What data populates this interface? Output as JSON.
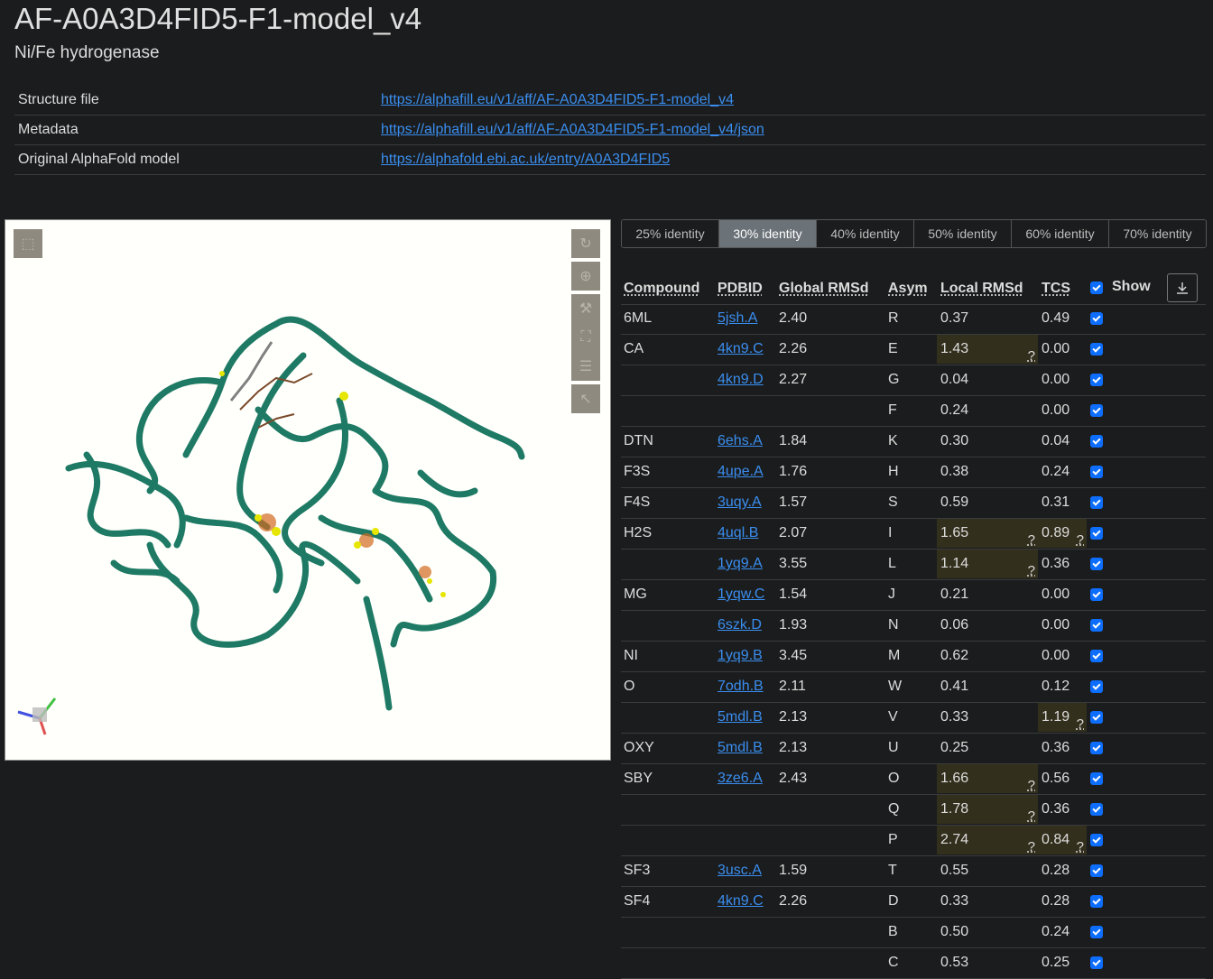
{
  "title": "AF-A0A3D4FID5-F1-model_v4",
  "subtitle": "Ni/Fe hydrogenase",
  "info": [
    {
      "key": "Structure file",
      "link": "https://alphafill.eu/v1/aff/AF-A0A3D4FID5-F1-model_v4"
    },
    {
      "key": "Metadata",
      "link": "https://alphafill.eu/v1/aff/AF-A0A3D4FID5-F1-model_v4/json"
    },
    {
      "key": "Original AlphaFold model",
      "link": "https://alphafold.ebi.ac.uk/entry/A0A3D4FID5"
    }
  ],
  "viewer": {
    "icons": [
      "cube-icon",
      "refresh-icon",
      "target-icon",
      "wrench-icon",
      "expand-icon",
      "sliders-icon",
      "cursor-icon"
    ]
  },
  "tabs": [
    "25% identity",
    "30% identity",
    "40% identity",
    "50% identity",
    "60% identity",
    "70% identity"
  ],
  "active_tab": 1,
  "columns": {
    "compound": "Compound",
    "pdbid": "PDBID",
    "global": "Global RMSd",
    "asym": "Asym",
    "local": "Local RMSd",
    "tcs": "TCS",
    "show": "Show"
  },
  "warn_mark": "?",
  "rows": [
    {
      "compound": "6ML",
      "pdbid": "5jsh.A",
      "global": "2.40",
      "asym": "R",
      "local": "0.37",
      "tcs": "0.49",
      "local_warn": false,
      "tcs_warn": false,
      "sep": true
    },
    {
      "compound": "CA",
      "pdbid": "4kn9.C",
      "global": "2.26",
      "asym": "E",
      "local": "1.43",
      "tcs": "0.00",
      "local_warn": true,
      "tcs_warn": false,
      "sep": true
    },
    {
      "compound": "",
      "pdbid": "4kn9.D",
      "global": "2.27",
      "asym": "G",
      "local": "0.04",
      "tcs": "0.00",
      "local_warn": false,
      "tcs_warn": false,
      "sep": true
    },
    {
      "compound": "",
      "pdbid": "",
      "global": "",
      "asym": "F",
      "local": "0.24",
      "tcs": "0.00",
      "local_warn": false,
      "tcs_warn": false,
      "sep": true
    },
    {
      "compound": "DTN",
      "pdbid": "6ehs.A",
      "global": "1.84",
      "asym": "K",
      "local": "0.30",
      "tcs": "0.04",
      "local_warn": false,
      "tcs_warn": false,
      "sep": true
    },
    {
      "compound": "F3S",
      "pdbid": "4upe.A",
      "global": "1.76",
      "asym": "H",
      "local": "0.38",
      "tcs": "0.24",
      "local_warn": false,
      "tcs_warn": false,
      "sep": true
    },
    {
      "compound": "F4S",
      "pdbid": "3uqy.A",
      "global": "1.57",
      "asym": "S",
      "local": "0.59",
      "tcs": "0.31",
      "local_warn": false,
      "tcs_warn": false,
      "sep": true
    },
    {
      "compound": "H2S",
      "pdbid": "4uql.B",
      "global": "2.07",
      "asym": "I",
      "local": "1.65",
      "tcs": "0.89",
      "local_warn": true,
      "tcs_warn": true,
      "sep": true
    },
    {
      "compound": "",
      "pdbid": "1yq9.A",
      "global": "3.55",
      "asym": "L",
      "local": "1.14",
      "tcs": "0.36",
      "local_warn": true,
      "tcs_warn": false,
      "sep": true
    },
    {
      "compound": "MG",
      "pdbid": "1yqw.C",
      "global": "1.54",
      "asym": "J",
      "local": "0.21",
      "tcs": "0.00",
      "local_warn": false,
      "tcs_warn": false,
      "sep": true
    },
    {
      "compound": "",
      "pdbid": "6szk.D",
      "global": "1.93",
      "asym": "N",
      "local": "0.06",
      "tcs": "0.00",
      "local_warn": false,
      "tcs_warn": false,
      "sep": true
    },
    {
      "compound": "NI",
      "pdbid": "1yq9.B",
      "global": "3.45",
      "asym": "M",
      "local": "0.62",
      "tcs": "0.00",
      "local_warn": false,
      "tcs_warn": false,
      "sep": true
    },
    {
      "compound": "O",
      "pdbid": "7odh.B",
      "global": "2.11",
      "asym": "W",
      "local": "0.41",
      "tcs": "0.12",
      "local_warn": false,
      "tcs_warn": false,
      "sep": true
    },
    {
      "compound": "",
      "pdbid": "5mdl.B",
      "global": "2.13",
      "asym": "V",
      "local": "0.33",
      "tcs": "1.19",
      "local_warn": false,
      "tcs_warn": true,
      "sep": true
    },
    {
      "compound": "OXY",
      "pdbid": "5mdl.B",
      "global": "2.13",
      "asym": "U",
      "local": "0.25",
      "tcs": "0.36",
      "local_warn": false,
      "tcs_warn": false,
      "sep": true
    },
    {
      "compound": "SBY",
      "pdbid": "3ze6.A",
      "global": "2.43",
      "asym": "O",
      "local": "1.66",
      "tcs": "0.56",
      "local_warn": true,
      "tcs_warn": false,
      "sep": true
    },
    {
      "compound": "",
      "pdbid": "",
      "global": "",
      "asym": "Q",
      "local": "1.78",
      "tcs": "0.36",
      "local_warn": true,
      "tcs_warn": false,
      "sep": true
    },
    {
      "compound": "",
      "pdbid": "",
      "global": "",
      "asym": "P",
      "local": "2.74",
      "tcs": "0.84",
      "local_warn": true,
      "tcs_warn": true,
      "sep": true
    },
    {
      "compound": "SF3",
      "pdbid": "3usc.A",
      "global": "1.59",
      "asym": "T",
      "local": "0.55",
      "tcs": "0.28",
      "local_warn": false,
      "tcs_warn": false,
      "sep": true
    },
    {
      "compound": "SF4",
      "pdbid": "4kn9.C",
      "global": "2.26",
      "asym": "D",
      "local": "0.33",
      "tcs": "0.28",
      "local_warn": false,
      "tcs_warn": false,
      "sep": true
    },
    {
      "compound": "",
      "pdbid": "",
      "global": "",
      "asym": "B",
      "local": "0.50",
      "tcs": "0.24",
      "local_warn": false,
      "tcs_warn": false,
      "sep": true
    },
    {
      "compound": "",
      "pdbid": "",
      "global": "",
      "asym": "C",
      "local": "0.53",
      "tcs": "0.25",
      "local_warn": false,
      "tcs_warn": false,
      "sep": true
    }
  ],
  "colors": {
    "background": "#1b1c1d",
    "link": "#3a8eef",
    "active_tab": "#6b7278",
    "warn_cell": "#332f1d",
    "checkbox": "#0d6efd",
    "protein": "#1e7a64"
  }
}
